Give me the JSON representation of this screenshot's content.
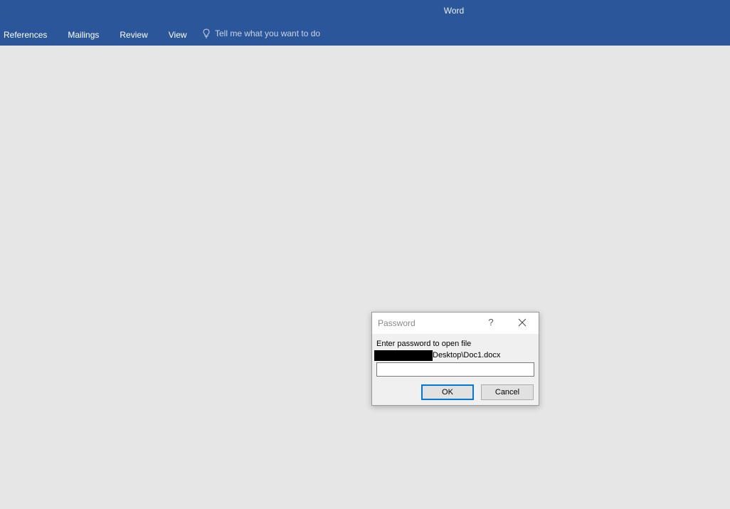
{
  "app": {
    "title": "Word"
  },
  "ribbon": {
    "tabs": [
      {
        "label": "References"
      },
      {
        "label": "Mailings"
      },
      {
        "label": "Review"
      },
      {
        "label": "View"
      }
    ],
    "tell_me": {
      "label": "Tell me what you want to do",
      "icon": "lightbulb-icon"
    }
  },
  "dialog": {
    "title": "Password",
    "help_label": "?",
    "prompt": "Enter password to open file",
    "path_suffix": "Desktop\\Doc1.docx",
    "password_value": "",
    "ok_label": "OK",
    "cancel_label": "Cancel"
  },
  "colors": {
    "titlebar": "#2b579a",
    "workspace": "#e6e6e6",
    "focus_border": "#0078d7"
  }
}
